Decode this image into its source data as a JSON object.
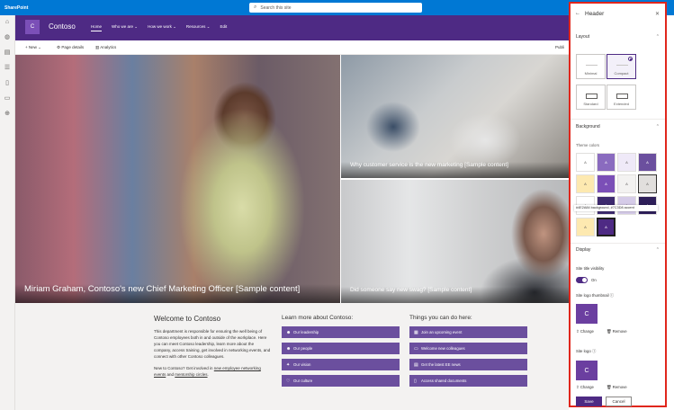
{
  "suite": {
    "app_name": "SharePoint",
    "search_placeholder": "Search this site"
  },
  "site": {
    "logo_letter": "C",
    "name": "Contoso"
  },
  "nav": [
    "Home",
    "Who we are",
    "How we work",
    "Resources",
    "Edit"
  ],
  "command_bar": {
    "new": "+ New",
    "page_details": "Page details",
    "analytics": "Analytics",
    "publish_edge": "Publi"
  },
  "hero": {
    "tile1_caption": "Miriam Graham, Contoso's new Chief Marketing Officer [Sample content]",
    "tile2_caption": "Why customer service is the new marketing [Sample content]",
    "tile3_caption": "Did someone say new swag? [Sample content]"
  },
  "welcome": {
    "title": "Welcome to Contoso",
    "body": "This department is responsible for ensuring the well being of Contoso employees both in and outside of the workplace. Here you can meet Contoso leadership, learn more about the company, access training, get involved in networking events, and connect with other Contoso colleagues.",
    "p2_prefix": "New to Contoso? Get involved in ",
    "p2_link1": "new employee networking events",
    "p2_mid": " and ",
    "p2_link2": "mentorship circles",
    "p2_suffix": "."
  },
  "learn": {
    "title": "Learn more about Contoso:",
    "items": [
      "Our leadership",
      "Our people",
      "Our vision",
      "Our culture"
    ]
  },
  "things": {
    "title": "Things you can do here:",
    "items": [
      "Join an upcoming event",
      "Welcome new colleagues",
      "Get the latest EE news",
      "Access shared documents"
    ]
  },
  "panel": {
    "title": "Header",
    "layout_label": "Layout",
    "layouts": [
      "Minimal",
      "Compact",
      "Standard",
      "Extended"
    ],
    "background_label": "Background",
    "theme_colors_label": "Theme colors",
    "swatch_glyph": "A",
    "tooltip": "#4E2A84 background, #7C3D8 accent",
    "display_label": "Display",
    "site_title_visibility": "Site title visibility",
    "toggle_state": "On",
    "thumbnail_label": "Site logo thumbnail",
    "logo_label": "Site logo",
    "change": "Change",
    "remove": "Remove",
    "save": "Save",
    "cancel": "Cancel"
  },
  "colors": {
    "suite": "#0078d4",
    "site_header": "#4e2a84",
    "accent": "#6b4f9e",
    "highlight_border": "#e0261c"
  }
}
